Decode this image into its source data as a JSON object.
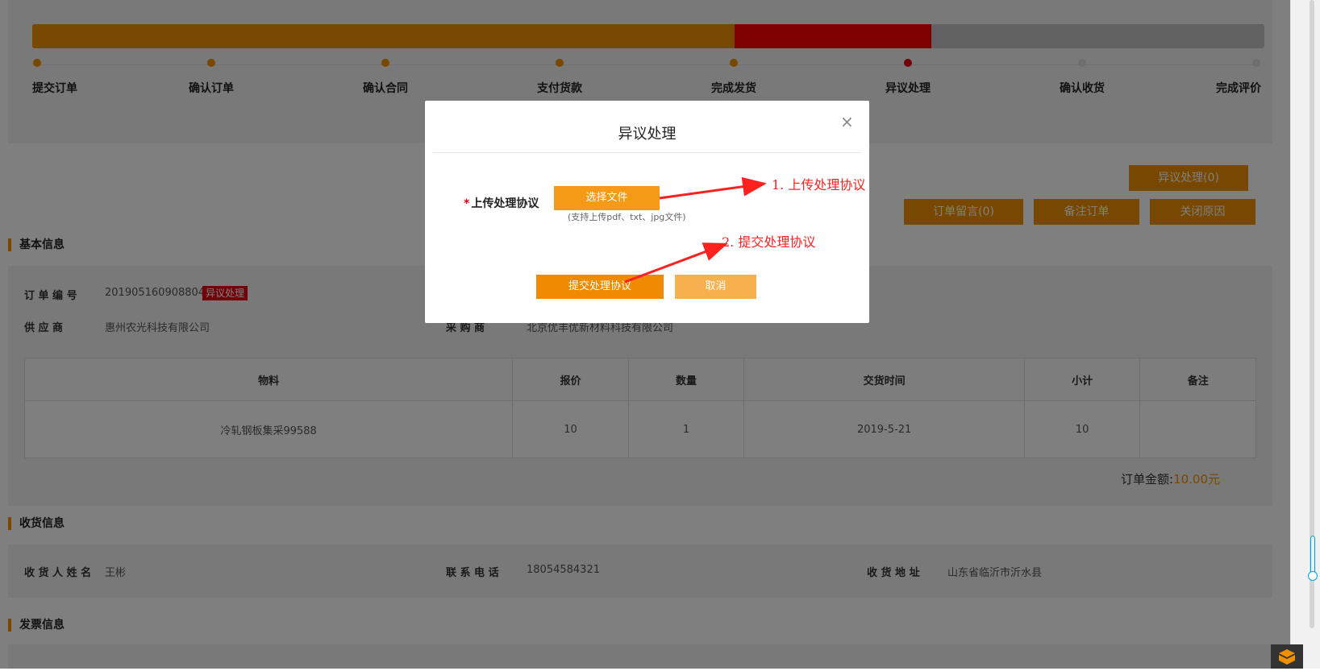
{
  "steps": {
    "items": [
      {
        "label": "提交订单",
        "state": "done"
      },
      {
        "label": "确认订单",
        "state": "done"
      },
      {
        "label": "确认合同",
        "state": "done"
      },
      {
        "label": "支付货款",
        "state": "done"
      },
      {
        "label": "完成发货",
        "state": "done"
      },
      {
        "label": "异议处理",
        "state": "current"
      },
      {
        "label": "确认收货",
        "state": "pending"
      },
      {
        "label": "完成评价",
        "state": "pending"
      }
    ],
    "progress_done_fraction": 0.57,
    "progress_current_fraction": 0.73
  },
  "actions": {
    "dispute": "异议处理(0)",
    "message": "订单留言(0)",
    "remark": "备注订单",
    "close_reason": "关闭原因"
  },
  "basic_info": {
    "title": "基本信息",
    "order_no_label": "订 单 编 号",
    "order_no": "20190516090880415",
    "status_badge": "异议处理",
    "supplier_label": "供 应 商",
    "supplier": "惠州农光科技有限公司",
    "buyer_label": "采 购 商",
    "buyer": "北京优丰优新材料科技有限公司"
  },
  "items_table": {
    "headers": [
      "物料",
      "报价",
      "数量",
      "交货时间",
      "小计",
      "备注"
    ],
    "rows": [
      [
        "冷轧钢板集采99588",
        "10",
        "1",
        "2019-5-21",
        "10",
        ""
      ]
    ]
  },
  "order_amount": {
    "label": "订单金额:",
    "value": "10.00元"
  },
  "receiving_info": {
    "title": "收货信息",
    "name_label": "收 货 人 姓 名",
    "name": "王彬",
    "phone_label": "联 系 电 话",
    "phone": "18054584321",
    "address_label": "收 货 地 址",
    "address": "山东省临沂市沂水县"
  },
  "invoice_info": {
    "title": "发票信息"
  },
  "modal": {
    "title": "异议处理",
    "close_glyph": "×",
    "field_required_mark": "*",
    "field_label": "上传处理协议",
    "choose_file": "选择文件",
    "file_hint": "(支持上传pdf、txt、jpg文件)",
    "submit": "提交处理协议",
    "cancel": "取消"
  },
  "annotations": {
    "step1": "1. 上传处理协议",
    "step2": "2. 提交处理协议"
  },
  "colors": {
    "accent": "#f08f00",
    "alert": "#e60012",
    "annotation": "#ff2020"
  }
}
